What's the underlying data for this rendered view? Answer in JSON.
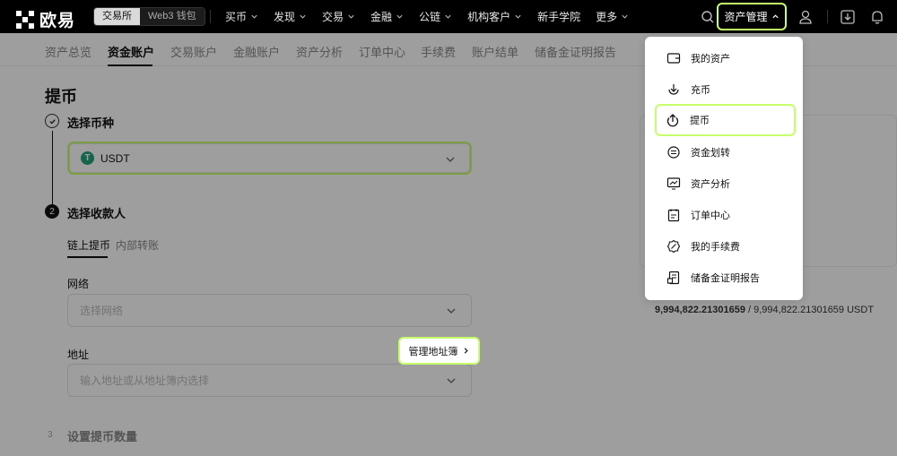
{
  "brand": {
    "name": "欧易"
  },
  "env_switch": {
    "exchange": "交易所",
    "web3": "Web3 钱包"
  },
  "nav": {
    "items": [
      "买币",
      "发现",
      "交易",
      "金融",
      "公链",
      "机构客户",
      "新手学院",
      "更多"
    ],
    "asset_menu": "资产管理"
  },
  "subtabs": [
    "资产总览",
    "资金账户",
    "交易账户",
    "金融账户",
    "资产分析",
    "订单中心",
    "手续费",
    "账户结单",
    "储备金证明报告"
  ],
  "page": {
    "title": "提币"
  },
  "steps": {
    "step1": {
      "label": "选择币种"
    },
    "step2": {
      "num": "2",
      "label": "选择收款人"
    },
    "step3": {
      "num": "3",
      "label": "设置提币数量"
    }
  },
  "coin": {
    "symbol": "USDT",
    "logo_letter": "T",
    "logo_color": "#26a17b"
  },
  "recipient_tabs": [
    "链上提币",
    "内部转账"
  ],
  "network": {
    "label": "网络",
    "placeholder": "选择网络"
  },
  "address": {
    "label": "地址",
    "placeholder": "输入地址或从地址簿内选择",
    "book_button": "管理地址簿"
  },
  "balance": {
    "available": "9,994,822.21301659",
    "total": "9,994,822.21301659 USDT"
  },
  "asset_dropdown": {
    "items": [
      {
        "label": "我的资产",
        "icon": "wallet-icon"
      },
      {
        "label": "充币",
        "icon": "deposit-icon"
      },
      {
        "label": "提币",
        "icon": "withdraw-icon"
      },
      {
        "label": "资金划转",
        "icon": "transfer-icon"
      },
      {
        "label": "资产分析",
        "icon": "analysis-icon"
      },
      {
        "label": "订单中心",
        "icon": "order-center-icon"
      },
      {
        "label": "我的手续费",
        "icon": "fee-icon"
      },
      {
        "label": "储备金证明报告",
        "icon": "reserve-report-icon"
      }
    ]
  },
  "colors": {
    "highlight": "#c5ff6a",
    "nav_bg": "#000000"
  }
}
